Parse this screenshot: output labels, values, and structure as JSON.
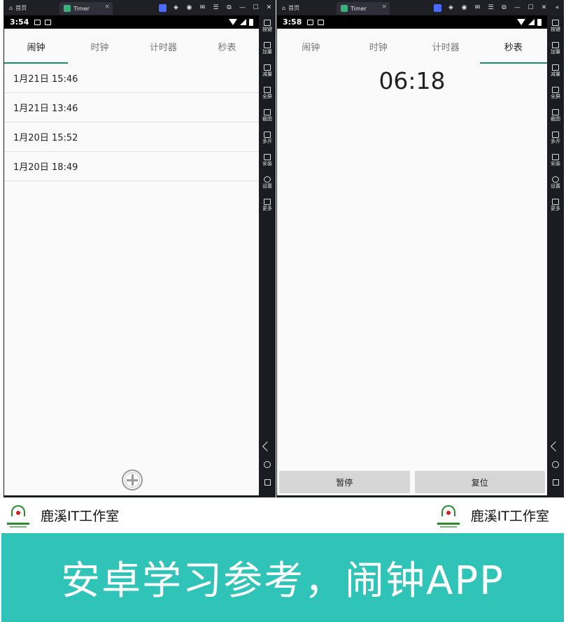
{
  "left_window": {
    "home_tab": "首页",
    "app_tab": "Timer",
    "close_glyph": "×",
    "status_time": "3:54",
    "tabs": [
      "闹钟",
      "时钟",
      "计时器",
      "秒表"
    ],
    "active_tab": 0,
    "alarms": [
      "1月21日 15:46",
      "1月21日 13:46",
      "1月20日 15:52",
      "1月20日 18:49"
    ]
  },
  "right_window": {
    "home_tab": "首页",
    "app_tab": "Timer",
    "close_glyph": "×",
    "status_time": "3:58",
    "tabs": [
      "闹钟",
      "时钟",
      "计时器",
      "秒表"
    ],
    "active_tab": 3,
    "stopwatch_time": "06:18",
    "pause_label": "暂停",
    "reset_label": "复位"
  },
  "window_controls": [
    "☰",
    "⧉",
    "—",
    "☐",
    "✕",
    "«"
  ],
  "sidebar": [
    {
      "label": "按键",
      "icon": "keyboard-icon"
    },
    {
      "label": "加量",
      "icon": "volume-up-icon"
    },
    {
      "label": "减量",
      "icon": "volume-down-icon"
    },
    {
      "label": "全屏",
      "icon": "fullscreen-icon"
    },
    {
      "label": "截图",
      "icon": "scissors-icon"
    },
    {
      "label": "多开",
      "icon": "multi-instance-icon"
    },
    {
      "label": "安装",
      "icon": "apk-install-icon"
    },
    {
      "label": "设置",
      "icon": "settings-icon"
    },
    {
      "label": "更多",
      "icon": "more-icon"
    }
  ],
  "brand": {
    "name": "鹿溪IT工作室"
  },
  "banner": {
    "text": "安卓学习参考，闹钟APP"
  },
  "colors": {
    "accent": "#1a8a6e",
    "banner": "#30c4b8",
    "emulator_frame": "#1b1b22"
  }
}
